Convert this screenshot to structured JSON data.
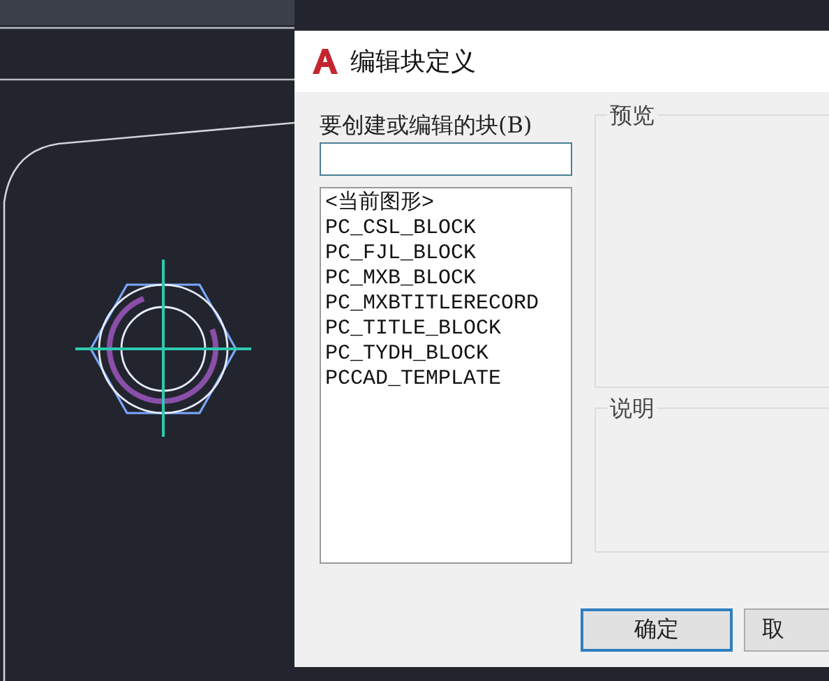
{
  "dialog": {
    "title": "编辑块定义",
    "block_label": "要创建或编辑的块(B)",
    "blocks": [
      {
        "name": "<当前图形>",
        "selected": false
      },
      {
        "name": "PC_CSL_BLOCK",
        "selected": false
      },
      {
        "name": "PC_FJL_BLOCK",
        "selected": false
      },
      {
        "name": "PC_MXB_BLOCK",
        "selected": false
      },
      {
        "name": "PC_MXBTITLERECORD",
        "selected": false
      },
      {
        "name": "PC_TITLE_BLOCK",
        "selected": false
      },
      {
        "name": "PC_TYDH_BLOCK",
        "selected": false
      },
      {
        "name": "PCCAD_TEMPLATE",
        "selected": false
      }
    ],
    "preview": {
      "label": "预览"
    },
    "description": {
      "label": "说明"
    },
    "buttons": [
      {
        "label": "确定",
        "default": true
      },
      {
        "label": "取",
        "default": false
      }
    ]
  }
}
